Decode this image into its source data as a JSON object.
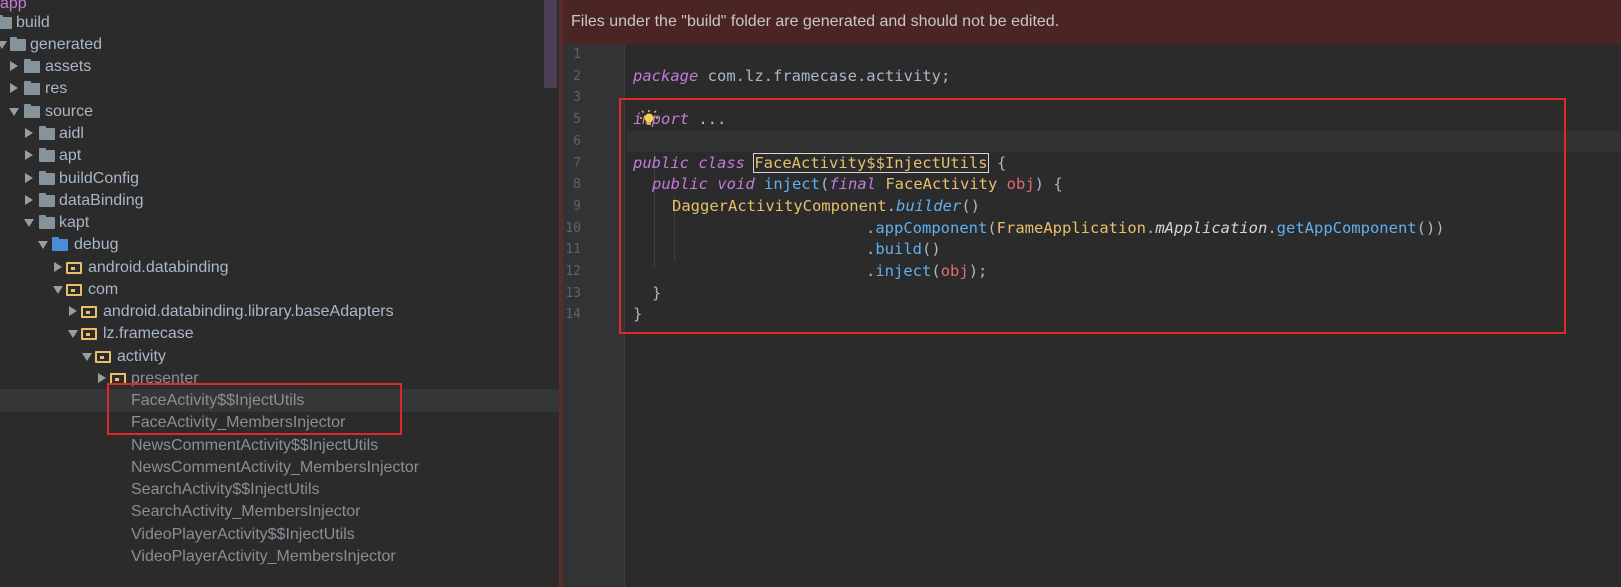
{
  "tree": {
    "rows": [
      {
        "label": "app",
        "kind": "app"
      },
      {
        "label": "build",
        "kind": "folder"
      },
      {
        "label": "generated",
        "kind": "folder"
      },
      {
        "label": "assets",
        "kind": "folder"
      },
      {
        "label": "res",
        "kind": "folder"
      },
      {
        "label": "source",
        "kind": "folder"
      },
      {
        "label": "aidl",
        "kind": "folder"
      },
      {
        "label": "apt",
        "kind": "folder"
      },
      {
        "label": "buildConfig",
        "kind": "folder"
      },
      {
        "label": "dataBinding",
        "kind": "folder"
      },
      {
        "label": "kapt",
        "kind": "folder"
      },
      {
        "label": "debug",
        "kind": "source-folder"
      },
      {
        "label": "android.databinding",
        "kind": "package"
      },
      {
        "label": "com",
        "kind": "package"
      },
      {
        "label": "android.databinding.library.baseAdapters",
        "kind": "package"
      },
      {
        "label": "lz.framecase",
        "kind": "package"
      },
      {
        "label": "activity",
        "kind": "package"
      },
      {
        "label": "presenter",
        "kind": "package"
      },
      {
        "label": "FaceActivity$$InjectUtils",
        "kind": "file",
        "selected": true
      },
      {
        "label": "FaceActivity_MembersInjector",
        "kind": "file"
      },
      {
        "label": "NewsCommentActivity$$InjectUtils",
        "kind": "file"
      },
      {
        "label": "NewsCommentActivity_MembersInjector",
        "kind": "file"
      },
      {
        "label": "SearchActivity$$InjectUtils",
        "kind": "file"
      },
      {
        "label": "SearchActivity_MembersInjector",
        "kind": "file"
      },
      {
        "label": "VideoPlayerActivity$$InjectUtils",
        "kind": "file"
      },
      {
        "label": "VideoPlayerActivity_MembersInjector",
        "kind": "file"
      }
    ]
  },
  "editor": {
    "banner": "Files under the \"build\" folder are generated and should not be edited.",
    "line_numbers": [
      "1",
      "2",
      "3",
      "5",
      "6",
      "7",
      "8",
      "9",
      "10",
      "11",
      "12",
      "13",
      "14"
    ],
    "code": {
      "l1_kw": "package",
      "l1_rest": " com.lz.framecase.activity;",
      "l3_kw": "import",
      "l3_rest": " ...",
      "l6_kw": "public class ",
      "l6_name": "FaceActivity$$InjectUtils",
      "l6_rest": " {",
      "l7_kw": "public void ",
      "l7_fn": "inject",
      "l7_p1": "(",
      "l7_final": "final ",
      "l7_type": "FaceActivity",
      "l7_sp": " ",
      "l7_param": "obj",
      "l7_end": ") {",
      "l8_type": "DaggerActivityComponent",
      "l8_dot": ".",
      "l8_fn": "builder",
      "l8_end": "()",
      "l9_dot": ".",
      "l9_fn": "appComponent",
      "l9_p": "(",
      "l9_type": "FrameApplication",
      "l9_dot2": ".",
      "l9_field": "mApplication",
      "l9_dot3": ".",
      "l9_fn2": "getAppComponent",
      "l9_end": "())",
      "l10_dot": ".",
      "l10_fn": "build",
      "l10_end": "()",
      "l11_dot": ".",
      "l11_fn": "inject",
      "l11_p": "(",
      "l11_param": "obj",
      "l11_end": ");",
      "l12": "}",
      "l13": "}"
    }
  },
  "colors": {
    "background": "#2b2b2b",
    "banner_bg": "#4b2424",
    "highlight_red": "#e02828",
    "keyword": "#cc7832",
    "type": "#e8bf6a",
    "function": "#61afef"
  },
  "icons": [
    "lightbulb-icon",
    "folder-icon",
    "package-icon",
    "expand-arrow-icon",
    "collapse-arrow-icon"
  ]
}
